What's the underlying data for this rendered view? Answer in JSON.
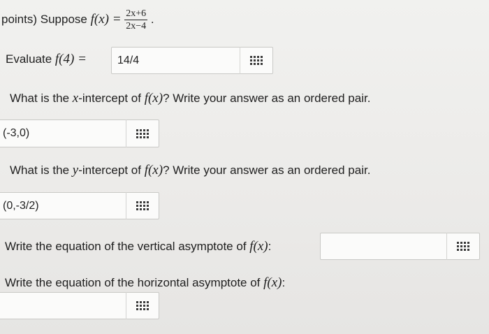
{
  "header": {
    "prefix": "points) Suppose",
    "fx": "f(x) =",
    "frac_num": "2x+6",
    "frac_den": "2x−4",
    "suffix": "."
  },
  "evaluate": {
    "label": "Evaluate",
    "expr": "f(4) =",
    "value": "14/4"
  },
  "q_x": {
    "text_a": "What is the ",
    "var": "x",
    "text_b": "-intercept of ",
    "fx": "f(x)",
    "text_c": "? Write your answer as an ordered pair.",
    "value": "(-3,0)"
  },
  "q_y": {
    "text_a": "What is the ",
    "var": "y",
    "text_b": "-intercept of ",
    "fx": "f(x)",
    "text_c": "? Write your answer as an ordered pair.",
    "value": "(0,-3/2)"
  },
  "q_vert": {
    "text": "Write the equation of the vertical asymptote of ",
    "fx": "f(x)",
    "colon": ":",
    "value": ""
  },
  "q_horiz": {
    "text": "Write the equation of the horizontal asymptote of ",
    "fx": "f(x)",
    "colon": ":",
    "value": ""
  },
  "icons": {
    "keyboard": "keyboard-grid-icon"
  }
}
